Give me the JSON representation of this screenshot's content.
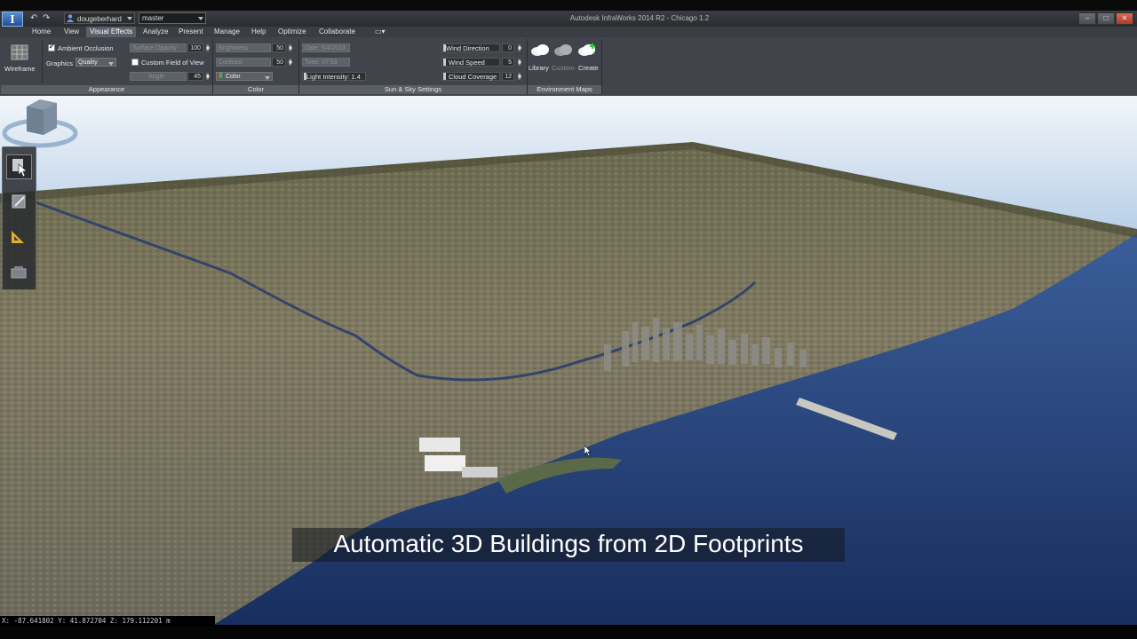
{
  "window": {
    "title": "Autodesk InfraWorks 2014 R2 - Chicago 1.2",
    "user": "dougeberhard",
    "branch": "master"
  },
  "menu": [
    "Home",
    "View",
    "Visual Effects",
    "Analyze",
    "Present",
    "Manage",
    "Help",
    "Optimize",
    "Collaborate"
  ],
  "menu_active": "Visual Effects",
  "ribbon": {
    "wireframe": "Wireframe",
    "appearance": {
      "ambient_occlusion": "Ambient Occlusion",
      "ambient_occlusion_checked": true,
      "graphics_label": "Graphics",
      "graphics_value": "Quality",
      "custom_fov": "Custom Field of View",
      "custom_fov_checked": false,
      "surface_opacity": "Surface Opacity",
      "surface_opacity_value": "100",
      "angle_label": "Angle",
      "angle_value": "45",
      "group_label": "Appearance"
    },
    "color": {
      "brightness_label": "Brightness",
      "brightness_value": "50",
      "contrast_label": "Contrast",
      "contrast_value": "50",
      "mode": "Color",
      "group_label": "Color"
    },
    "sun_sky": {
      "date_label": "Date: 5/4/2013",
      "time_label": "Time: 07:53",
      "light_intensity": "Light Intensity:  1.4",
      "wind_direction": "Wind Direction",
      "wind_direction_value": "0",
      "wind_speed": "Wind Speed",
      "wind_speed_value": "5",
      "cloud_coverage": "Cloud Coverage",
      "cloud_coverage_value": "12",
      "group_label": "Sun & Sky Settings"
    },
    "environment": {
      "library": "Library",
      "custom": "Custom",
      "create": "Create",
      "group_label": "Environment Maps"
    }
  },
  "caption": "Automatic 3D Buildings from 2D Footprints",
  "status": "X: -87.641802 Y: 41.872704 Z: 179.112201 m",
  "icons": [
    "app-logo-icon",
    "undo-icon",
    "redo-icon",
    "user-icon",
    "select-tool-icon",
    "edit-tool-icon",
    "measure-tool-icon",
    "layers-tool-icon",
    "view-cube-icon",
    "cloud-icon"
  ]
}
